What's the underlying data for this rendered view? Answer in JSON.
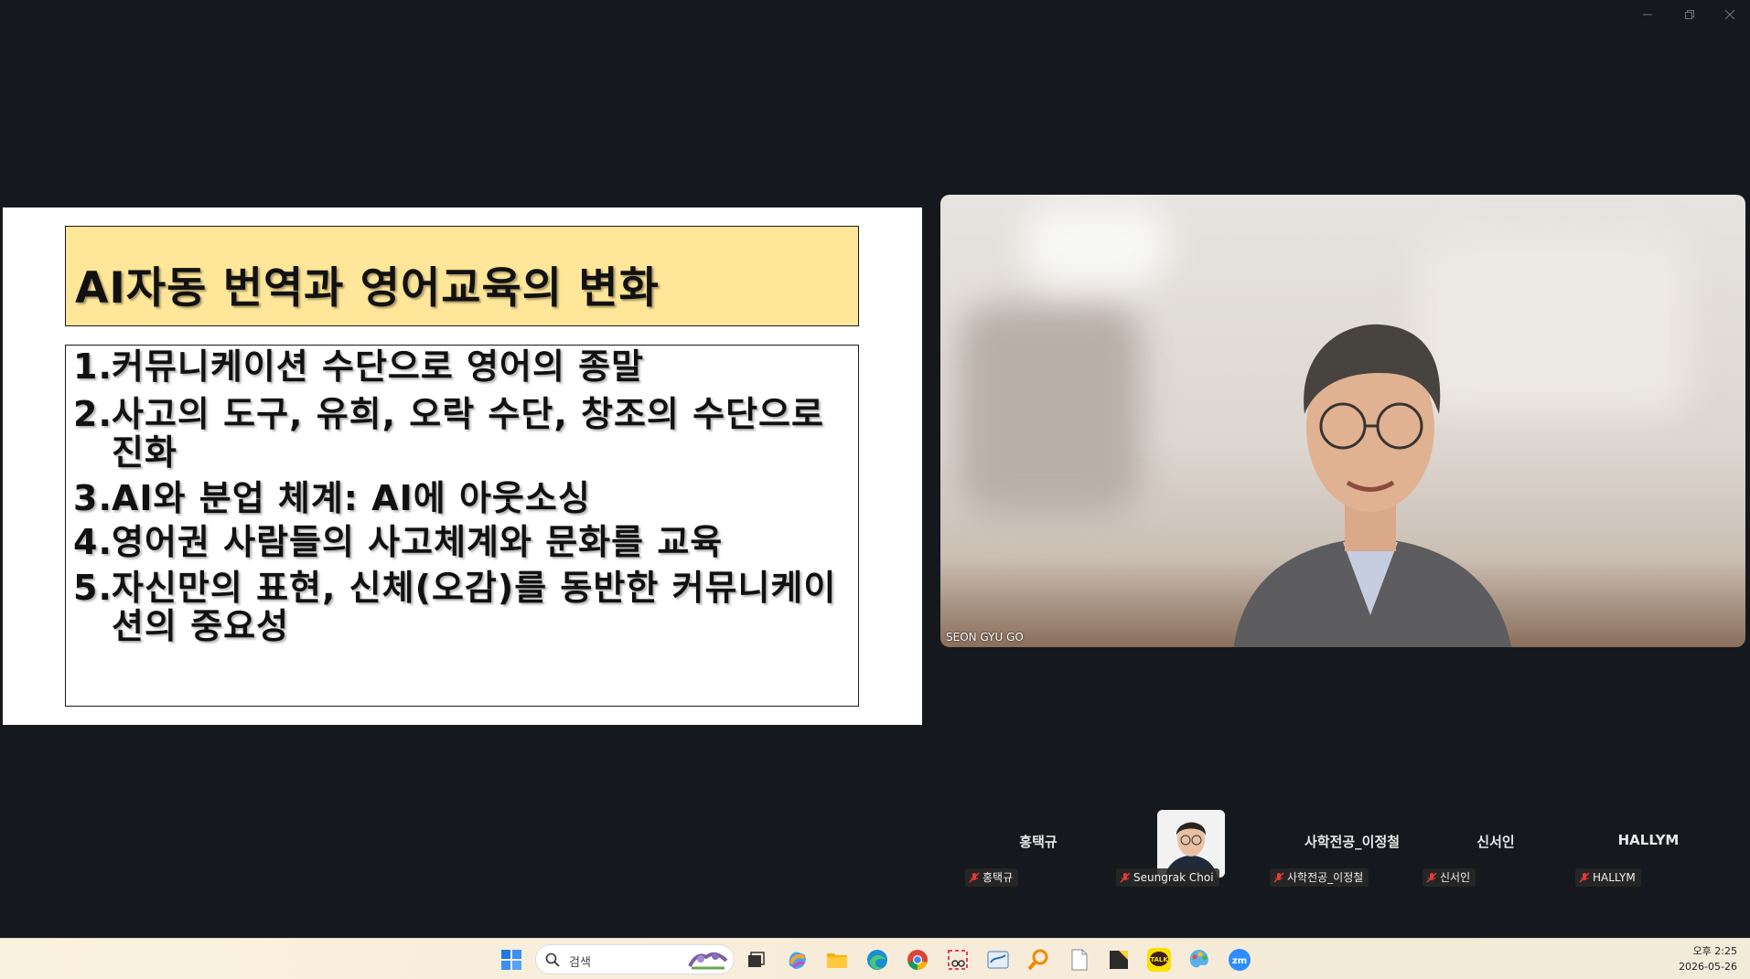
{
  "window": {
    "minimize_icon": "minimize-icon",
    "restore_icon": "restore-icon",
    "close_icon": "close-icon"
  },
  "slide": {
    "title": "AI자동 번역과 영어교육의 변화",
    "points": [
      {
        "num": "1.",
        "text": "커뮤니케이션 수단으로 영어의 종말"
      },
      {
        "num": "2.",
        "text": "사고의 도구, 유희, 오락 수단, 창조의 수단으로",
        "text2": "진화"
      },
      {
        "num": "3.",
        "text": "AI와 분업 체계: AI에 아웃소싱"
      },
      {
        "num": "4.",
        "text": "영어권 사람들의 사고체계와 문화를 교육"
      },
      {
        "num": "5.",
        "text": "자신만의 표현, 신체(오감)를 동반한 커뮤니케이",
        "text2": "션의 중요성"
      }
    ],
    "title_bg": "#ffe699"
  },
  "speaker": {
    "name": "SEON GYU GO"
  },
  "participants": [
    {
      "name": "홍택규",
      "label": "홍택규",
      "muted": true
    },
    {
      "name": "",
      "label": "Seungrak Choi",
      "muted": true,
      "has_video_avatar": true
    },
    {
      "name": "사학전공_이정철",
      "label": "사학전공_이정철",
      "muted": true
    },
    {
      "name": "신서인",
      "label": "신서인",
      "muted": true
    },
    {
      "name": "HALLYM",
      "label": "HALLYM",
      "muted": true
    }
  ],
  "taskbar": {
    "search_placeholder": "검색",
    "icons": [
      "windows-start-icon",
      "task-view-icon",
      "copilot-icon",
      "file-explorer-icon",
      "edge-icon",
      "chrome-icon",
      "snipping-tool-icon",
      "app-icon",
      "search-app-icon",
      "file-icon",
      "sticky-notes-icon",
      "kakaotalk-icon",
      "paint-icon",
      "zoom-icon"
    ],
    "kakao_label": "TALK",
    "clock_time": "오후 2:25",
    "clock_date": "2026-05-26"
  },
  "colors": {
    "background": "#15181d",
    "mic_muted": "#e53935",
    "zoom_blue": "#2d8cff"
  }
}
